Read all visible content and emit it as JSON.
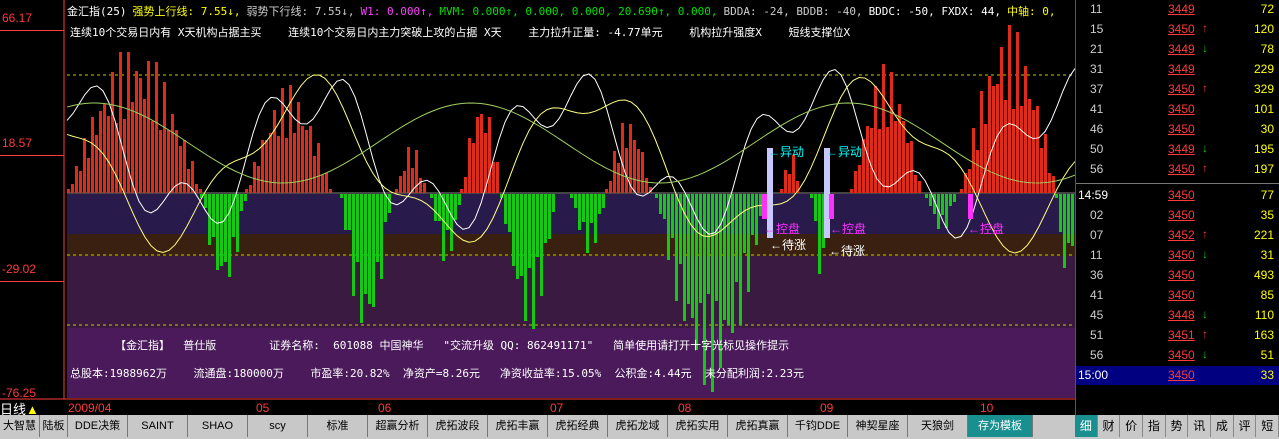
{
  "colors": {
    "up": "#e02a1a",
    "down": "#14c814",
    "axis": "#ff3a3a",
    "yellow": "#ffff00",
    "cyan": "#00ffff",
    "magenta": "#ff30ff"
  },
  "yaxis": {
    "labels": [
      "66.17",
      "18.57",
      "-29.02",
      "-76.25"
    ]
  },
  "header": {
    "items": [
      {
        "text": "金汇指(25)",
        "color": "#ffffff"
      },
      {
        "text": "强势上行线: 7.55↓,",
        "color": "#ffff00"
      },
      {
        "text": "弱势下行线: 7.55↓,",
        "color": "#cccccc"
      },
      {
        "text": "W1: 0.000↑,",
        "color": "#ff40ff"
      },
      {
        "text": "MVM: 0.000↑, 0.000, 0.000, 20.690↑, 0.000,",
        "color": "#00e000"
      },
      {
        "text": "BDDA: -24, BDDB: -40,",
        "color": "#cccccc"
      },
      {
        "text": "BDDC: -50, FXDX: 44,",
        "color": "#ffffff"
      },
      {
        "text": "中轴: 0,",
        "color": "#ffff00"
      }
    ],
    "row2": [
      "连续10个交易日内有 X天机构占据主买",
      "连续10个交易日内主力突破上攻的占据 X天",
      "主力拉升正量: -4.77单元",
      "机构拉升强度X",
      "短线支撑位X"
    ]
  },
  "info": {
    "line1": "【金汇指】  普仕版        证券名称:  601088 中国神华   \"交流升级 QQ: 862491171\"   简单使用请打开十字光标见操作提示",
    "line2": "总股本:1988962万    流通盘:180000万    市盈率:20.82%  净资产=8.26元   净资收益率:15.05%  公积金:4.44元  未分配利润:2.23元"
  },
  "annotations": {
    "yidong": "异动",
    "kongpan": "控盘",
    "daizhang": "待涨"
  },
  "xaxis": {
    "labels": [
      "2009/04",
      "05",
      "06",
      "07",
      "08",
      "09",
      "10"
    ],
    "period": "日线",
    "marker": "▲"
  },
  "bottom_tabs": [
    "大智慧",
    "陆板",
    "DDE决策",
    "SAINT",
    "SHAO",
    "scy",
    "标准",
    "超赢分析",
    "虎拓波段",
    "虎拓丰赢",
    "虎拓经典",
    "虎拓龙域",
    "虎拓实用",
    "虎拓真赢",
    "千钧DDE",
    "神契星座",
    "天狼剑",
    "存为模板"
  ],
  "active_tab": "存为模板",
  "ticks": [
    {
      "time": "11",
      "price": "3449",
      "arrow": "",
      "vol": "72"
    },
    {
      "time": "15",
      "price": "3450",
      "arrow": "↑",
      "vol": "120"
    },
    {
      "time": "21",
      "price": "3449",
      "arrow": "↓",
      "vol": "78"
    },
    {
      "time": "31",
      "price": "3449",
      "arrow": "",
      "vol": "229"
    },
    {
      "time": "37",
      "price": "3450",
      "arrow": "↑",
      "vol": "329"
    },
    {
      "time": "41",
      "price": "3450",
      "arrow": "",
      "vol": "101"
    },
    {
      "time": "46",
      "price": "3450",
      "arrow": "",
      "vol": "30"
    },
    {
      "time": "50",
      "price": "3449",
      "arrow": "↓",
      "vol": "195"
    },
    {
      "time": "56",
      "price": "3450",
      "arrow": "↑",
      "vol": "197"
    },
    {
      "time": "14:59",
      "price": "3450",
      "arrow": "",
      "vol": "77"
    },
    {
      "time": "02",
      "price": "3450",
      "arrow": "",
      "vol": "35"
    },
    {
      "time": "07",
      "price": "3452",
      "arrow": "↑",
      "vol": "221"
    },
    {
      "time": "11",
      "price": "3450",
      "arrow": "↓",
      "vol": "31"
    },
    {
      "time": "36",
      "price": "3450",
      "arrow": "",
      "vol": "493"
    },
    {
      "time": "41",
      "price": "3450",
      "arrow": "",
      "vol": "85"
    },
    {
      "time": "45",
      "price": "3448",
      "arrow": "↓",
      "vol": "110"
    },
    {
      "time": "51",
      "price": "3451",
      "arrow": "↑",
      "vol": "163"
    },
    {
      "time": "56",
      "price": "3450",
      "arrow": "↓",
      "vol": "51"
    },
    {
      "time": "15:00",
      "price": "3450",
      "arrow": "",
      "vol": "33"
    }
  ],
  "side_tabs": [
    "细",
    "财",
    "价",
    "指",
    "势",
    "讯",
    "成",
    "评",
    "短"
  ],
  "active_side_tab": "细"
}
